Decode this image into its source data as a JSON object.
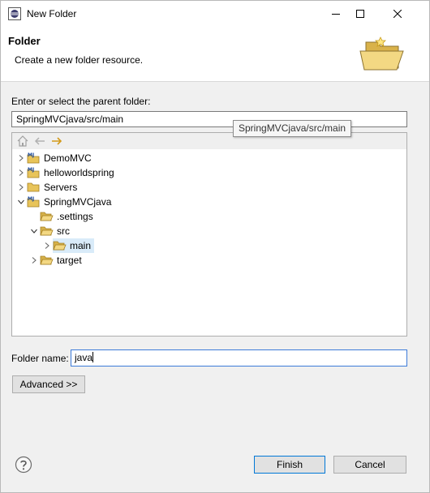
{
  "window": {
    "title": "New Folder"
  },
  "banner": {
    "title": "Folder",
    "description": "Create a new folder resource."
  },
  "parent": {
    "label": "Enter or select the parent folder:",
    "value": "SpringMVCjava/src/main",
    "tooltip": "SpringMVCjava/src/main"
  },
  "tree": {
    "items": [
      {
        "label": "DemoMVC",
        "icon": "java-project-icon",
        "expander": "collapsed"
      },
      {
        "label": "helloworldspring",
        "icon": "java-project-icon",
        "expander": "collapsed"
      },
      {
        "label": "Servers",
        "icon": "folder-icon",
        "expander": "collapsed"
      },
      {
        "label": "SpringMVCjava",
        "icon": "java-project-icon",
        "expander": "expanded"
      },
      {
        "label": ".settings",
        "icon": "folder-open-icon",
        "expander": "none"
      },
      {
        "label": "src",
        "icon": "folder-open-icon",
        "expander": "expanded"
      },
      {
        "label": "main",
        "icon": "folder-open-icon",
        "expander": "collapsed",
        "selected": true
      },
      {
        "label": "target",
        "icon": "folder-open-icon",
        "expander": "collapsed"
      }
    ]
  },
  "folder_name": {
    "label": "Folder name:",
    "value": "java"
  },
  "buttons": {
    "advanced": "Advanced >>",
    "finish": "Finish",
    "cancel": "Cancel"
  },
  "colors": {
    "selection": "#d9ebf9",
    "focus_border": "#0078d7",
    "folder": "#e8c45a"
  }
}
